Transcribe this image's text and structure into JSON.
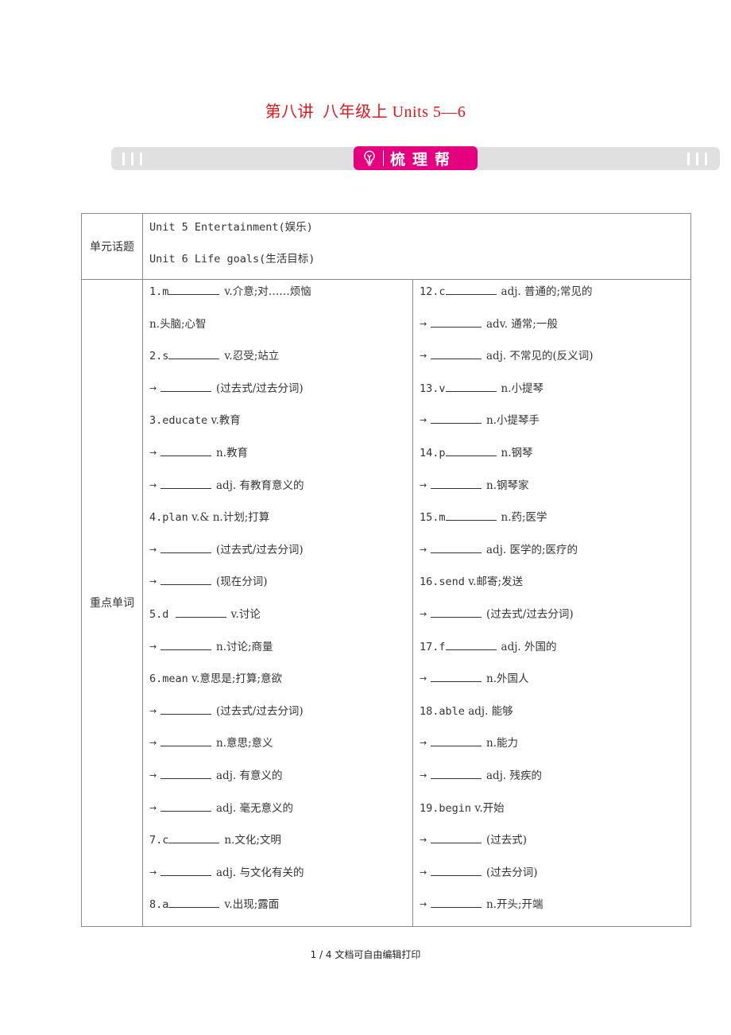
{
  "document": {
    "title": "第八讲  八年级上 Units 5—6",
    "banner_label": "梳理帮",
    "banner_icon": "lightbulb-icon",
    "accent_color": "#e4007f",
    "title_color": "#e8141c"
  },
  "topics": {
    "header": "单元话题",
    "lines": [
      "Unit 5 Entertainment(娱乐)",
      "Unit 6 Life goals(生活目标)"
    ]
  },
  "vocab": {
    "header": "重点单词",
    "left": [
      {
        "prefix": "1.m",
        "blank": true,
        "suffix": "v.介意;对……烦恼"
      },
      {
        "prefix": "",
        "blank": false,
        "suffix": "n.头脑;心智"
      },
      {
        "prefix": "2.s",
        "blank": true,
        "suffix": "v.忍受;站立"
      },
      {
        "arrow": true,
        "blank": true,
        "suffix": "(过去式/过去分词)"
      },
      {
        "prefix": "3.educate",
        "blank": false,
        "suffix": "v.教育"
      },
      {
        "arrow": true,
        "blank": true,
        "suffix": "n.教育"
      },
      {
        "arrow": true,
        "blank": true,
        "suffix": "adj. 有教育意义的"
      },
      {
        "prefix": "4.plan",
        "blank": false,
        "suffix": "v.& n.计划;打算"
      },
      {
        "arrow": true,
        "blank": true,
        "suffix": "(过去式/过去分词)"
      },
      {
        "arrow": true,
        "blank": true,
        "suffix": "(现在分词)"
      },
      {
        "prefix": "5.d ",
        "blank": true,
        "suffix": "v.讨论"
      },
      {
        "arrow": true,
        "blank": true,
        "suffix": "n.讨论;商量"
      },
      {
        "prefix": "6.mean",
        "blank": false,
        "suffix": "v.意思是;打算;意欲"
      },
      {
        "arrow": true,
        "blank": true,
        "suffix": "(过去式/过去分词)"
      },
      {
        "arrow": true,
        "blank": true,
        "suffix": "n.意思;意义"
      },
      {
        "arrow": true,
        "blank": true,
        "suffix": "adj. 有意义的"
      },
      {
        "arrow": true,
        "blank": true,
        "suffix": "adj. 毫无意义的"
      },
      {
        "prefix": "7.c",
        "blank": true,
        "suffix": "n.文化;文明"
      },
      {
        "arrow": true,
        "blank": true,
        "suffix": "adj. 与文化有关的"
      },
      {
        "prefix": "8.a",
        "blank": true,
        "suffix": "v.出现;露面"
      }
    ],
    "right": [
      {
        "prefix": "12.c",
        "blank": true,
        "suffix": "adj. 普通的;常见的"
      },
      {
        "arrow": true,
        "blank": true,
        "suffix": "adv. 通常;一般"
      },
      {
        "arrow": true,
        "blank": true,
        "suffix": "adj. 不常见的(反义词)"
      },
      {
        "prefix": "13.v",
        "blank": true,
        "suffix": "n.小提琴"
      },
      {
        "arrow": true,
        "blank": true,
        "suffix": "n.小提琴手"
      },
      {
        "prefix": "14.p",
        "blank": true,
        "suffix": "n.钢琴"
      },
      {
        "arrow": true,
        "blank": true,
        "suffix": "n.钢琴家"
      },
      {
        "prefix": "15.m",
        "blank": true,
        "suffix": "n.药;医学"
      },
      {
        "arrow": true,
        "blank": true,
        "suffix": "adj. 医学的;医疗的"
      },
      {
        "prefix": "16.send",
        "blank": false,
        "suffix": "v.邮寄;发送"
      },
      {
        "arrow": true,
        "blank": true,
        "suffix": "(过去式/过去分词)"
      },
      {
        "prefix": "17.f",
        "blank": true,
        "suffix": "adj. 外国的"
      },
      {
        "arrow": true,
        "blank": true,
        "suffix": "n.外国人"
      },
      {
        "prefix": "18.able",
        "blank": false,
        "suffix": "adj. 能够"
      },
      {
        "arrow": true,
        "blank": true,
        "suffix": "n.能力"
      },
      {
        "arrow": true,
        "blank": true,
        "suffix": "adj. 残疾的"
      },
      {
        "prefix": "19.begin",
        "blank": false,
        "suffix": "v.开始"
      },
      {
        "arrow": true,
        "blank": true,
        "suffix": "(过去式)"
      },
      {
        "arrow": true,
        "blank": true,
        "suffix": "(过去分词)"
      },
      {
        "arrow": true,
        "blank": true,
        "suffix": "n.开头;开端"
      }
    ]
  },
  "footer": {
    "text": "1 / 4 文档可自由编辑打印"
  }
}
